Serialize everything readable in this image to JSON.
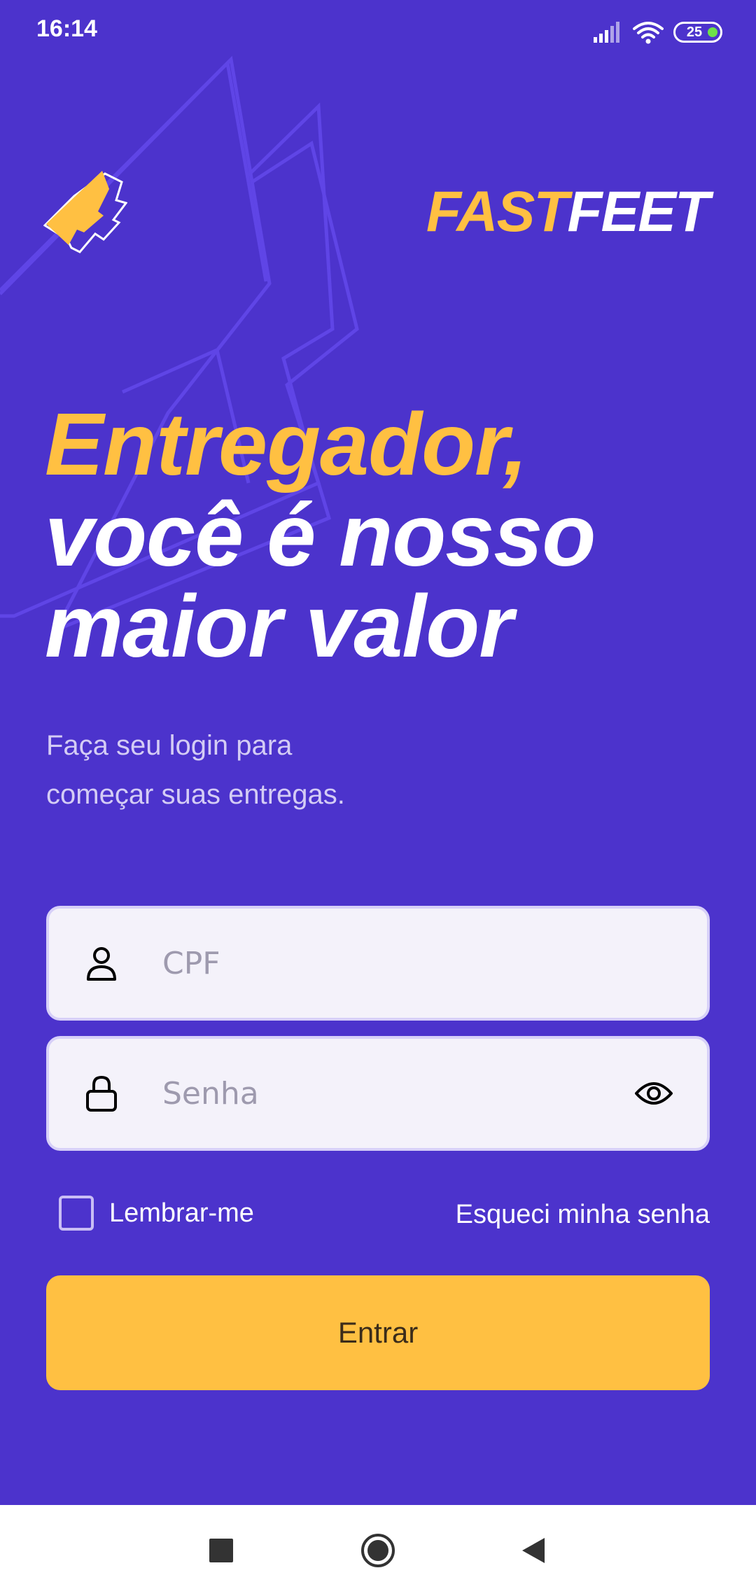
{
  "status_bar": {
    "time": "16:14",
    "battery_level": "25"
  },
  "brand": {
    "fast": "FAST",
    "feet": "FEET"
  },
  "headline": {
    "line1": "Entregador,",
    "line2": "você é nosso",
    "line3": "maior valor"
  },
  "subtitle": {
    "line1": "Faça seu login para",
    "line2": "começar suas entregas."
  },
  "form": {
    "cpf_placeholder": "CPF",
    "cpf_value": "",
    "password_placeholder": "Senha",
    "password_value": "",
    "remember_label": "Lembrar-me",
    "remember_checked": false,
    "forgot_label": "Esqueci minha senha",
    "submit_label": "Entrar"
  },
  "icons": {
    "cpf": "user-icon",
    "password": "lock-icon",
    "toggle_password": "eye-icon",
    "nav_recent": "square-icon",
    "nav_home": "circle-icon",
    "nav_back": "triangle-back-icon"
  },
  "colors": {
    "background": "#4C33CC",
    "accent": "#FFC042",
    "input_background": "#F4F2FA",
    "input_border": "#D7D0F8"
  }
}
